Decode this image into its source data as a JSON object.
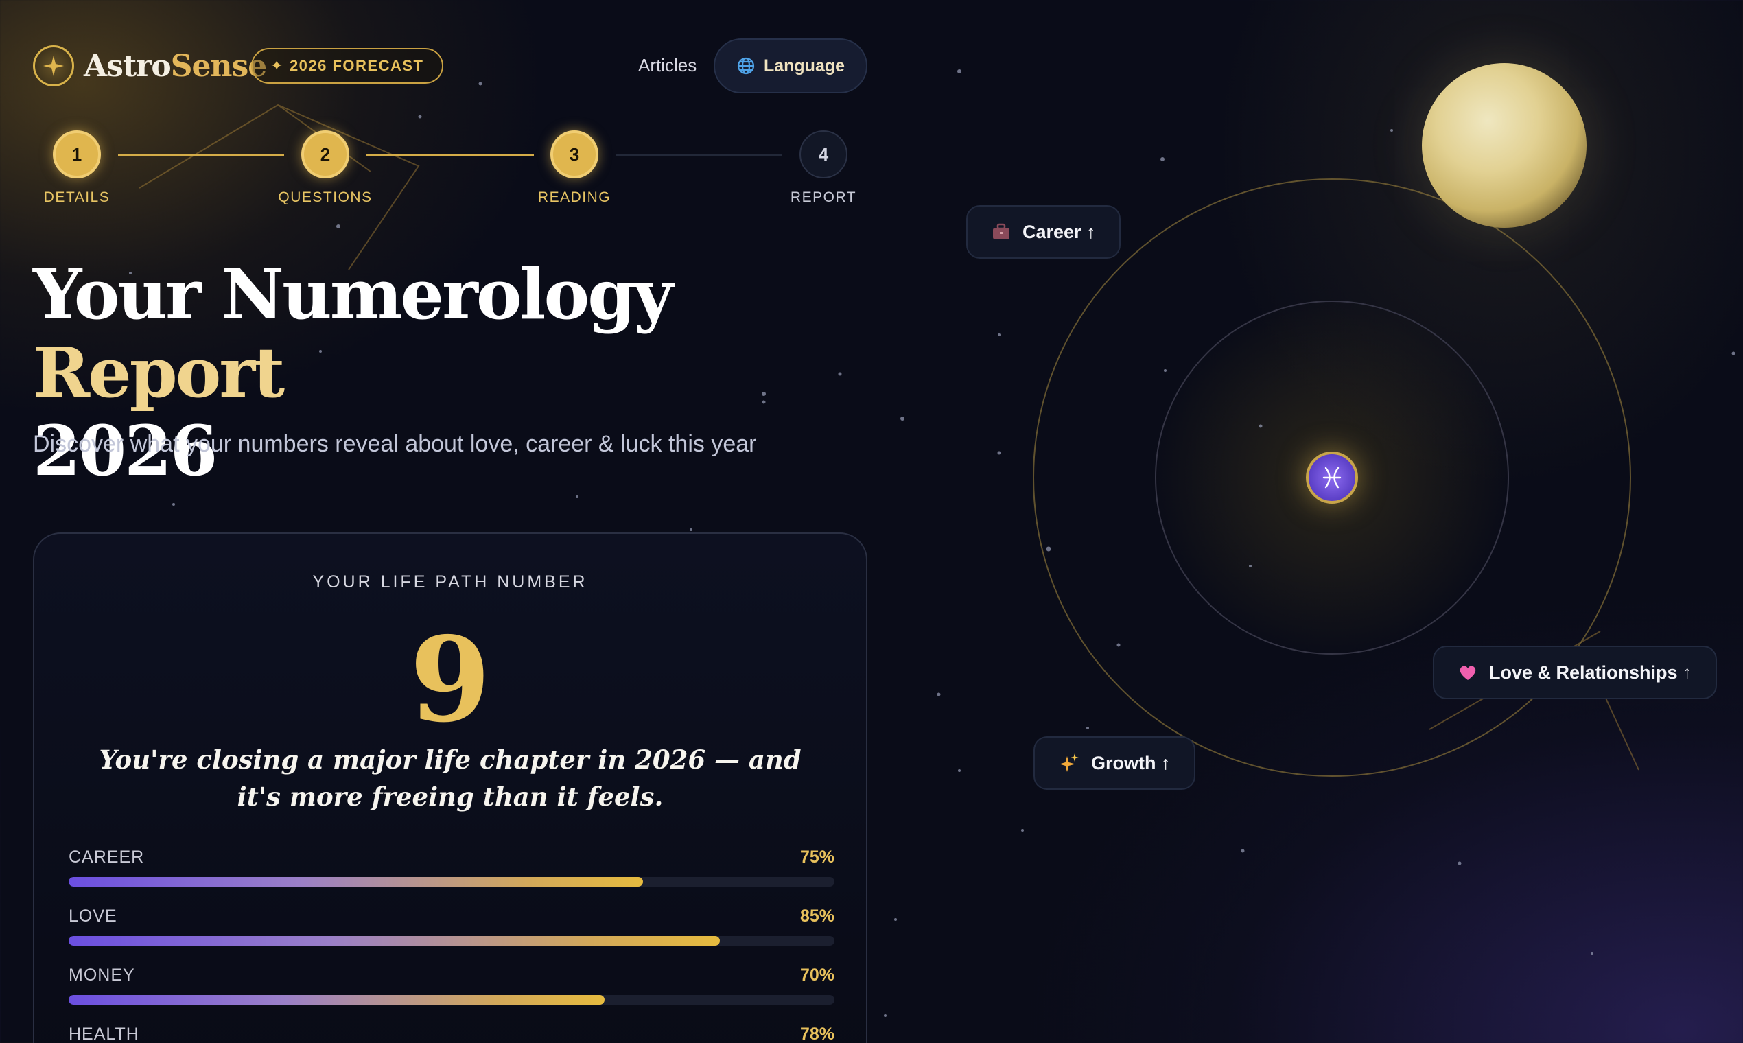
{
  "brand": {
    "name_part1": "Astro",
    "name_part2": "Sense",
    "badge": "2026 FORECAST"
  },
  "nav": {
    "articles": "Articles",
    "language": "Language"
  },
  "stepper": [
    {
      "number": "1",
      "label": "DETAILS",
      "state": "done"
    },
    {
      "number": "2",
      "label": "QUESTIONS",
      "state": "done"
    },
    {
      "number": "3",
      "label": "READING",
      "state": "done"
    },
    {
      "number": "4",
      "label": "REPORT",
      "state": "todo"
    }
  ],
  "hero": {
    "title_white": "Your Numerology",
    "title_gold": "Report",
    "title_line2": "2026",
    "subtitle": "Discover what your numbers reveal about love, career & luck this year"
  },
  "life_path_card": {
    "eyebrow": "YOUR LIFE PATH NUMBER",
    "number": "9",
    "tagline": "You're closing a major life chapter in 2026 — and it's more freeing than it feels.",
    "meters": [
      {
        "name": "CAREER",
        "label": "75%",
        "value": 0.75
      },
      {
        "name": "LOVE",
        "label": "85%",
        "value": 0.85
      },
      {
        "name": "MONEY",
        "label": "70%",
        "value": 0.7
      },
      {
        "name": "HEALTH",
        "label": "78%",
        "value": 0.78
      }
    ]
  },
  "orbit_tags": {
    "career": "Career ↑",
    "love": "Love & Relationships ↑",
    "growth": "Growth ↑"
  },
  "colors": {
    "gold": "#e8c15c",
    "background": "#0a0c18",
    "accent_purple": "#6b4fe0"
  }
}
